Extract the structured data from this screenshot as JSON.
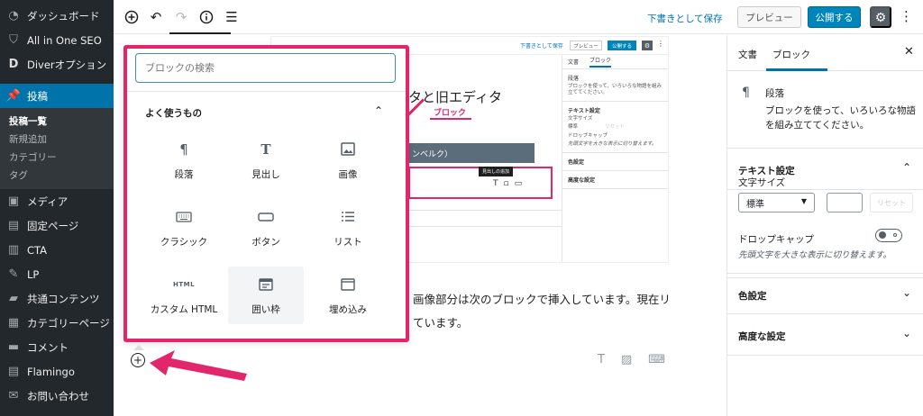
{
  "admin_menu": {
    "items_top": [
      {
        "label": "ダッシュボード",
        "icon": "dashboard-icon"
      },
      {
        "label": "All in One SEO",
        "icon": "shield-icon"
      },
      {
        "label": "Diverオプション",
        "icon": "diver-icon"
      }
    ],
    "active": {
      "label": "投稿",
      "icon": "pin-icon"
    },
    "submenu": [
      "投稿一覧",
      "新規追加",
      "カテゴリー",
      "タグ"
    ],
    "items_bottom": [
      {
        "label": "メディア",
        "icon": "media-icon"
      },
      {
        "label": "固定ページ",
        "icon": "page-icon"
      },
      {
        "label": "CTA",
        "icon": "cta-icon"
      },
      {
        "label": "LP",
        "icon": "lp-icon"
      },
      {
        "label": "共通コンテンツ",
        "icon": "folder-icon"
      },
      {
        "label": "カテゴリーページ",
        "icon": "grid-icon"
      },
      {
        "label": "コメント",
        "icon": "comment-icon"
      },
      {
        "label": "Flamingo",
        "icon": "flamingo-icon"
      },
      {
        "label": "お問い合わせ",
        "icon": "mail-icon"
      }
    ]
  },
  "toolbar": {
    "save_draft": "下書きとして保存",
    "preview": "プレビュー",
    "publish": "公開する"
  },
  "embedded": {
    "save_draft": "下書きとして保存",
    "preview": "プレビュー",
    "publish": "公開する",
    "title_fragment": "タと旧エディタ",
    "block_label": "ブロック",
    "band_text": "ンベルク）",
    "tooltip": "見出しの追加",
    "side_tab_doc": "文書",
    "side_tab_block": "ブロック",
    "side_paragraph": "段落",
    "side_paragraph_desc": "ブロックを使って、いろいろな物語を組み立ててください。",
    "side_text_settings": "テキスト設定",
    "side_font_size": "文字サイズ",
    "side_select": "標準",
    "side_reset": "リセット",
    "side_drop_cap": "ドロップキャップ",
    "side_drop_cap_help": "先頭文字を大きな表示に切り替えます。",
    "side_color": "色設定",
    "side_advanced": "高度な設定"
  },
  "content": {
    "line1": "画像部分は次のブロックで挿入しています。現在リ",
    "line2": "ています。"
  },
  "inserter": {
    "search_placeholder": "ブロックの検索",
    "section_title": "よく使うもの",
    "blocks": [
      {
        "label": "段落",
        "icon": "paragraph-icon"
      },
      {
        "label": "見出し",
        "icon": "heading-icon"
      },
      {
        "label": "画像",
        "icon": "image-icon"
      },
      {
        "label": "クラシック",
        "icon": "keyboard-icon"
      },
      {
        "label": "ボタン",
        "icon": "button-icon"
      },
      {
        "label": "リスト",
        "icon": "list-icon"
      },
      {
        "label": "カスタム HTML",
        "icon": "html-icon",
        "icon_text": "HTML"
      },
      {
        "label": "囲い枠",
        "icon": "frame-icon"
      },
      {
        "label": "埋め込み",
        "icon": "embed-icon"
      }
    ]
  },
  "settings_sidebar": {
    "tab_document": "文書",
    "tab_block": "ブロック",
    "block_name": "段落",
    "block_desc": "ブロックを使って、いろいろな物語を組み立ててください。",
    "text_settings": "テキスト設定",
    "font_size_label": "文字サイズ",
    "font_size_value": "標準",
    "reset": "リセット",
    "drop_cap_label": "ドロップキャップ",
    "drop_cap_help": "先頭文字を大きな表示に切り替えます。",
    "color_settings": "色設定",
    "advanced_settings": "高度な設定"
  },
  "colors": {
    "admin_bg": "#23282d",
    "admin_active": "#0073aa",
    "highlight": "#e2266c",
    "publish": "#0085ba"
  }
}
